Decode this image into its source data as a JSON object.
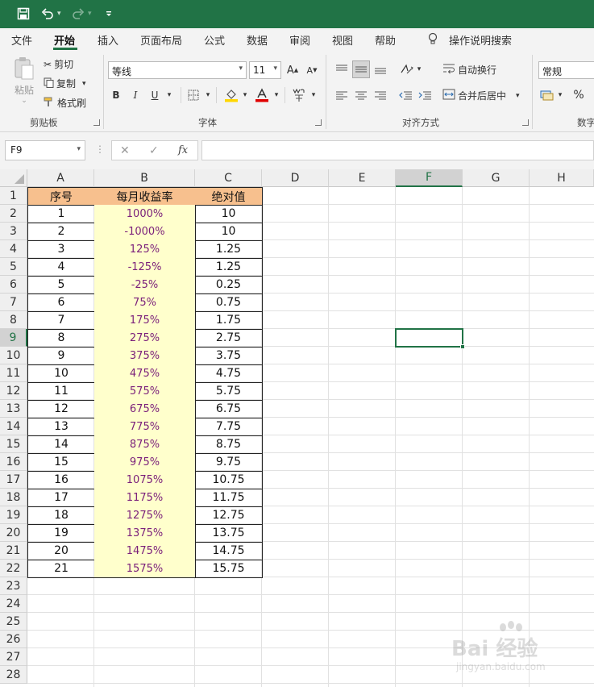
{
  "titlebar": {
    "icons": [
      "save-icon",
      "undo-icon",
      "redo-icon",
      "customize-qat-icon"
    ]
  },
  "menu": {
    "tabs": [
      "文件",
      "开始",
      "插入",
      "页面布局",
      "公式",
      "数据",
      "审阅",
      "视图",
      "帮助"
    ],
    "active": "开始",
    "tell_me": "操作说明搜索"
  },
  "ribbon": {
    "clipboard": {
      "paste": "粘贴",
      "cut": "剪切",
      "copy": "复制",
      "format_painter": "格式刷",
      "group": "剪贴板"
    },
    "font": {
      "name": "等线",
      "size": "11",
      "bold": "B",
      "italic": "I",
      "underline": "U",
      "grow": "A",
      "shrink": "A",
      "group": "字体"
    },
    "alignment": {
      "wrap_text": "自动换行",
      "merge_center": "合并后居中",
      "group": "对齐方式"
    },
    "number": {
      "format": "常规",
      "percent": "%",
      "group": "数字"
    }
  },
  "formula_bar": {
    "name_box": "F9",
    "fx": "fx",
    "cancel": "✕",
    "enter": "✓",
    "value": ""
  },
  "grid": {
    "columns": [
      "A",
      "B",
      "C",
      "D",
      "E",
      "F",
      "G",
      "H"
    ],
    "selected_column": "F",
    "selected_row": "9",
    "rows": [
      "1",
      "2",
      "3",
      "4",
      "5",
      "6",
      "7",
      "8",
      "9",
      "10",
      "11",
      "12",
      "13",
      "14",
      "15",
      "16",
      "17",
      "18",
      "19",
      "20",
      "21",
      "22",
      "23",
      "24",
      "25",
      "26",
      "27",
      "28"
    ],
    "headers": [
      "序号",
      "每月收益率",
      "绝对值"
    ],
    "data": [
      [
        "1",
        "1000%",
        "10"
      ],
      [
        "2",
        "-1000%",
        "10"
      ],
      [
        "3",
        "125%",
        "1.25"
      ],
      [
        "4",
        "-125%",
        "1.25"
      ],
      [
        "5",
        "-25%",
        "0.25"
      ],
      [
        "6",
        "75%",
        "0.75"
      ],
      [
        "7",
        "175%",
        "1.75"
      ],
      [
        "8",
        "275%",
        "2.75"
      ],
      [
        "9",
        "375%",
        "3.75"
      ],
      [
        "10",
        "475%",
        "4.75"
      ],
      [
        "11",
        "575%",
        "5.75"
      ],
      [
        "12",
        "675%",
        "6.75"
      ],
      [
        "13",
        "775%",
        "7.75"
      ],
      [
        "14",
        "875%",
        "8.75"
      ],
      [
        "15",
        "975%",
        "9.75"
      ],
      [
        "16",
        "1075%",
        "10.75"
      ],
      [
        "17",
        "1175%",
        "11.75"
      ],
      [
        "18",
        "1275%",
        "12.75"
      ],
      [
        "19",
        "1375%",
        "13.75"
      ],
      [
        "20",
        "1475%",
        "14.75"
      ],
      [
        "21",
        "1575%",
        "15.75"
      ]
    ]
  },
  "watermark": {
    "text": "Bai 经验",
    "sub": "jingyan.baidu.com"
  },
  "colors": {
    "accent": "#217346",
    "header_fill": "#f7c08e",
    "rate_fill": "#ffffcc",
    "rate_text": "#7a1f7a"
  }
}
